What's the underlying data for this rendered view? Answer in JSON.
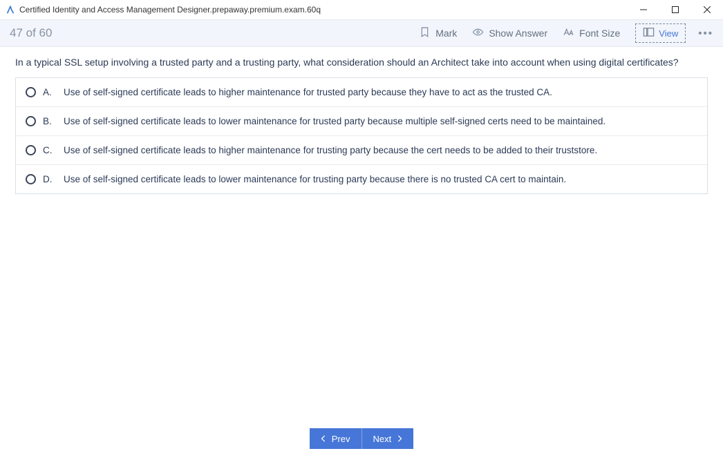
{
  "window": {
    "title": "Certified Identity and Access Management Designer.prepaway.premium.exam.60q"
  },
  "toolbar": {
    "progress": "47 of 60",
    "mark": "Mark",
    "show_answer": "Show Answer",
    "font_size": "Font Size",
    "view": "View"
  },
  "question": {
    "text": "In a typical SSL setup involving a trusted party and a trusting party, what consideration should an Architect take into account when using digital certificates?",
    "options": [
      {
        "letter": "A.",
        "text": "Use of self-signed certificate leads to higher maintenance for trusted party because they have to act as the trusted CA."
      },
      {
        "letter": "B.",
        "text": "Use of self-signed certificate leads to lower maintenance for trusted party because multiple self-signed certs need to be maintained."
      },
      {
        "letter": "C.",
        "text": "Use of self-signed certificate leads to higher maintenance for trusting party because the cert needs to be added to their truststore."
      },
      {
        "letter": "D.",
        "text": "Use of self-signed certificate leads to lower maintenance for trusting party because there is no trusted CA cert to maintain."
      }
    ]
  },
  "footer": {
    "prev": "Prev",
    "next": "Next"
  }
}
